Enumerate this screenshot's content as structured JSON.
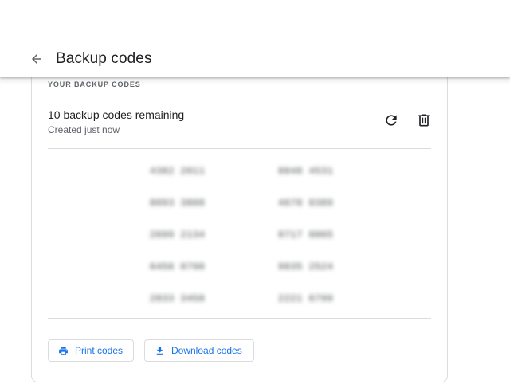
{
  "header": {
    "title": "Backup codes"
  },
  "card": {
    "section_label": "YOUR BACKUP CODES",
    "remaining": "10 backup codes remaining",
    "created": "Created just now",
    "codes_left": [
      "4382 2011",
      "8093 3808",
      "2699 2134",
      "6456 0798",
      "2833 3458"
    ],
    "codes_right": [
      "8848 4531",
      "4678 8389",
      "0717 8865",
      "9835 2524",
      "2221 6799"
    ]
  },
  "actions": {
    "print_label": "Print codes",
    "download_label": "Download codes"
  },
  "colors": {
    "accent": "#1a73e8",
    "text": "#202124",
    "muted": "#5f6368",
    "border": "#dadce0"
  },
  "icons": {
    "back": "arrow-left-icon",
    "refresh": "refresh-icon",
    "delete": "trash-icon",
    "print": "printer-icon",
    "download": "download-icon"
  }
}
